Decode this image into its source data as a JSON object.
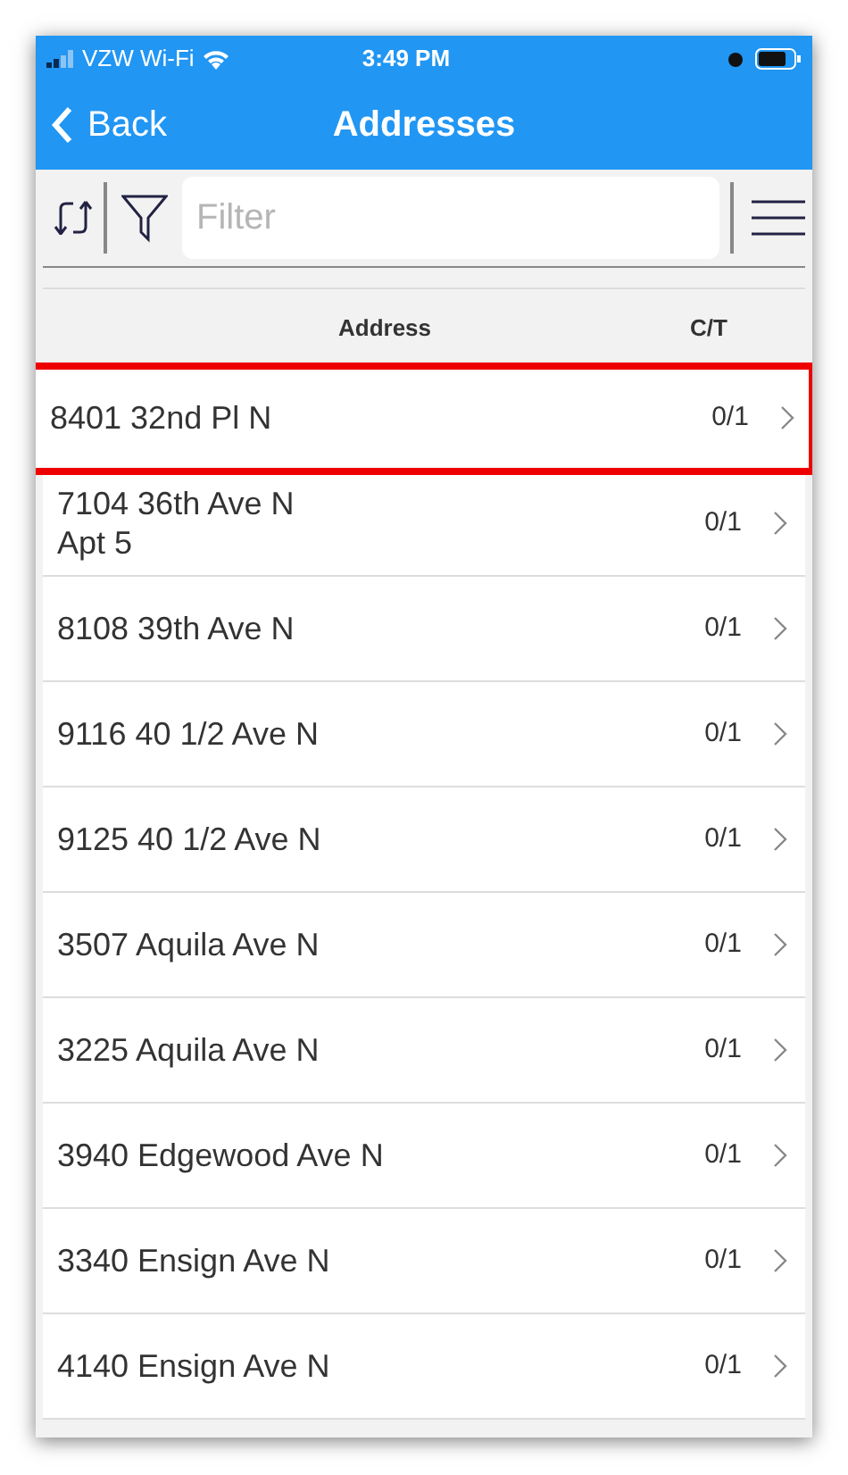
{
  "status_bar": {
    "carrier": "VZW Wi-Fi",
    "time": "3:49 PM"
  },
  "nav": {
    "back": "Back",
    "title": "Addresses"
  },
  "toolbar": {
    "filter": {
      "placeholder": "Filter"
    }
  },
  "table": {
    "columns": [
      "Address",
      "C/T"
    ],
    "rows": [
      {
        "lines": [
          "8401 32nd Pl N"
        ],
        "count": "0/1",
        "highlighted": true
      },
      {
        "lines": [
          "7104 36th Ave N",
          "Apt 5"
        ],
        "count": "0/1",
        "highlighted": false
      },
      {
        "lines": [
          "8108 39th Ave N"
        ],
        "count": "0/1",
        "highlighted": false
      },
      {
        "lines": [
          "9116 40 1/2 Ave N"
        ],
        "count": "0/1",
        "highlighted": false
      },
      {
        "lines": [
          "9125 40 1/2 Ave N"
        ],
        "count": "0/1",
        "highlighted": false
      },
      {
        "lines": [
          "3507 Aquila Ave N"
        ],
        "count": "0/1",
        "highlighted": false
      },
      {
        "lines": [
          "3225 Aquila Ave N"
        ],
        "count": "0/1",
        "highlighted": false
      },
      {
        "lines": [
          "3940 Edgewood Ave N"
        ],
        "count": "0/1",
        "highlighted": false
      },
      {
        "lines": [
          "3340 Ensign Ave N"
        ],
        "count": "0/1",
        "highlighted": false
      },
      {
        "lines": [
          "4140 Ensign Ave N"
        ],
        "count": "0/1",
        "highlighted": false
      }
    ]
  }
}
